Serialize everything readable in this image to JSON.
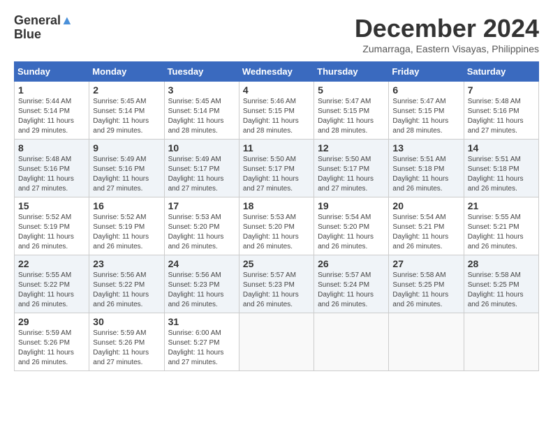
{
  "header": {
    "logo_line1": "General",
    "logo_line2": "Blue",
    "month_title": "December 2024",
    "location": "Zumarraga, Eastern Visayas, Philippines"
  },
  "weekdays": [
    "Sunday",
    "Monday",
    "Tuesday",
    "Wednesday",
    "Thursday",
    "Friday",
    "Saturday"
  ],
  "weeks": [
    [
      {
        "day": "1",
        "sunrise": "5:44 AM",
        "sunset": "5:14 PM",
        "daylight": "11 hours and 29 minutes."
      },
      {
        "day": "2",
        "sunrise": "5:45 AM",
        "sunset": "5:14 PM",
        "daylight": "11 hours and 29 minutes."
      },
      {
        "day": "3",
        "sunrise": "5:45 AM",
        "sunset": "5:14 PM",
        "daylight": "11 hours and 28 minutes."
      },
      {
        "day": "4",
        "sunrise": "5:46 AM",
        "sunset": "5:15 PM",
        "daylight": "11 hours and 28 minutes."
      },
      {
        "day": "5",
        "sunrise": "5:47 AM",
        "sunset": "5:15 PM",
        "daylight": "11 hours and 28 minutes."
      },
      {
        "day": "6",
        "sunrise": "5:47 AM",
        "sunset": "5:15 PM",
        "daylight": "11 hours and 28 minutes."
      },
      {
        "day": "7",
        "sunrise": "5:48 AM",
        "sunset": "5:16 PM",
        "daylight": "11 hours and 27 minutes."
      }
    ],
    [
      {
        "day": "8",
        "sunrise": "5:48 AM",
        "sunset": "5:16 PM",
        "daylight": "11 hours and 27 minutes."
      },
      {
        "day": "9",
        "sunrise": "5:49 AM",
        "sunset": "5:16 PM",
        "daylight": "11 hours and 27 minutes."
      },
      {
        "day": "10",
        "sunrise": "5:49 AM",
        "sunset": "5:17 PM",
        "daylight": "11 hours and 27 minutes."
      },
      {
        "day": "11",
        "sunrise": "5:50 AM",
        "sunset": "5:17 PM",
        "daylight": "11 hours and 27 minutes."
      },
      {
        "day": "12",
        "sunrise": "5:50 AM",
        "sunset": "5:17 PM",
        "daylight": "11 hours and 27 minutes."
      },
      {
        "day": "13",
        "sunrise": "5:51 AM",
        "sunset": "5:18 PM",
        "daylight": "11 hours and 26 minutes."
      },
      {
        "day": "14",
        "sunrise": "5:51 AM",
        "sunset": "5:18 PM",
        "daylight": "11 hours and 26 minutes."
      }
    ],
    [
      {
        "day": "15",
        "sunrise": "5:52 AM",
        "sunset": "5:19 PM",
        "daylight": "11 hours and 26 minutes."
      },
      {
        "day": "16",
        "sunrise": "5:52 AM",
        "sunset": "5:19 PM",
        "daylight": "11 hours and 26 minutes."
      },
      {
        "day": "17",
        "sunrise": "5:53 AM",
        "sunset": "5:20 PM",
        "daylight": "11 hours and 26 minutes."
      },
      {
        "day": "18",
        "sunrise": "5:53 AM",
        "sunset": "5:20 PM",
        "daylight": "11 hours and 26 minutes."
      },
      {
        "day": "19",
        "sunrise": "5:54 AM",
        "sunset": "5:20 PM",
        "daylight": "11 hours and 26 minutes."
      },
      {
        "day": "20",
        "sunrise": "5:54 AM",
        "sunset": "5:21 PM",
        "daylight": "11 hours and 26 minutes."
      },
      {
        "day": "21",
        "sunrise": "5:55 AM",
        "sunset": "5:21 PM",
        "daylight": "11 hours and 26 minutes."
      }
    ],
    [
      {
        "day": "22",
        "sunrise": "5:55 AM",
        "sunset": "5:22 PM",
        "daylight": "11 hours and 26 minutes."
      },
      {
        "day": "23",
        "sunrise": "5:56 AM",
        "sunset": "5:22 PM",
        "daylight": "11 hours and 26 minutes."
      },
      {
        "day": "24",
        "sunrise": "5:56 AM",
        "sunset": "5:23 PM",
        "daylight": "11 hours and 26 minutes."
      },
      {
        "day": "25",
        "sunrise": "5:57 AM",
        "sunset": "5:23 PM",
        "daylight": "11 hours and 26 minutes."
      },
      {
        "day": "26",
        "sunrise": "5:57 AM",
        "sunset": "5:24 PM",
        "daylight": "11 hours and 26 minutes."
      },
      {
        "day": "27",
        "sunrise": "5:58 AM",
        "sunset": "5:25 PM",
        "daylight": "11 hours and 26 minutes."
      },
      {
        "day": "28",
        "sunrise": "5:58 AM",
        "sunset": "5:25 PM",
        "daylight": "11 hours and 26 minutes."
      }
    ],
    [
      {
        "day": "29",
        "sunrise": "5:59 AM",
        "sunset": "5:26 PM",
        "daylight": "11 hours and 26 minutes."
      },
      {
        "day": "30",
        "sunrise": "5:59 AM",
        "sunset": "5:26 PM",
        "daylight": "11 hours and 27 minutes."
      },
      {
        "day": "31",
        "sunrise": "6:00 AM",
        "sunset": "5:27 PM",
        "daylight": "11 hours and 27 minutes."
      },
      null,
      null,
      null,
      null
    ]
  ]
}
